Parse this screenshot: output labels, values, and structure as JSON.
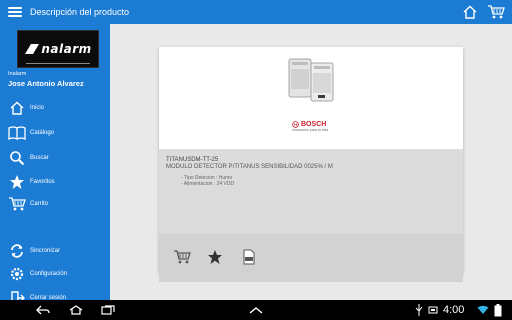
{
  "header": {
    "title": "Descripción del producto",
    "menu_icon": "hamburger-menu-icon",
    "actions": [
      "home-icon",
      "shopping-cart-icon"
    ]
  },
  "sidebar": {
    "company": "Inalarm",
    "user": "Jose Antonio Alvarez",
    "logo_text": "nalarm",
    "items": [
      {
        "label": "Inicio",
        "icon": "home-icon"
      },
      {
        "label": "Catálogo",
        "icon": "book-icon"
      },
      {
        "label": "Buscar",
        "icon": "search-icon"
      },
      {
        "label": "Favoritos",
        "icon": "star-icon"
      },
      {
        "label": "Carrito",
        "icon": "shopping-cart-icon"
      },
      {
        "label": "Sincronizar",
        "icon": "sync-icon"
      },
      {
        "label": "Configuración",
        "icon": "gear-icon"
      },
      {
        "label": "Cerrar sesión",
        "icon": "logout-icon"
      }
    ]
  },
  "product": {
    "code": "TITANUSDM-TT-25",
    "description": "MODULO DETECTOR P/TITANUS SENSIBILIDAD 0025% / M",
    "details": [
      "- Tipo Detecion : Humo",
      "- Alimentacion : 24 VDD"
    ],
    "brand": "BOSCH",
    "brand_tagline": "Innovación para tu vida",
    "actions": [
      "add-to-cart-icon",
      "favorite-star-icon",
      "pdf-document-icon"
    ]
  },
  "status_bar": {
    "time": "4:00",
    "icons": [
      "back-icon",
      "home-icon",
      "recent-apps-icon",
      "chevron-up-icon",
      "usb-icon",
      "screenshot-icon",
      "wifi-icon",
      "battery-icon"
    ]
  },
  "colors": {
    "primary": "#1c7bd3",
    "card_info_bg": "#dcdcdc",
    "brand_red": "#c8202f"
  }
}
